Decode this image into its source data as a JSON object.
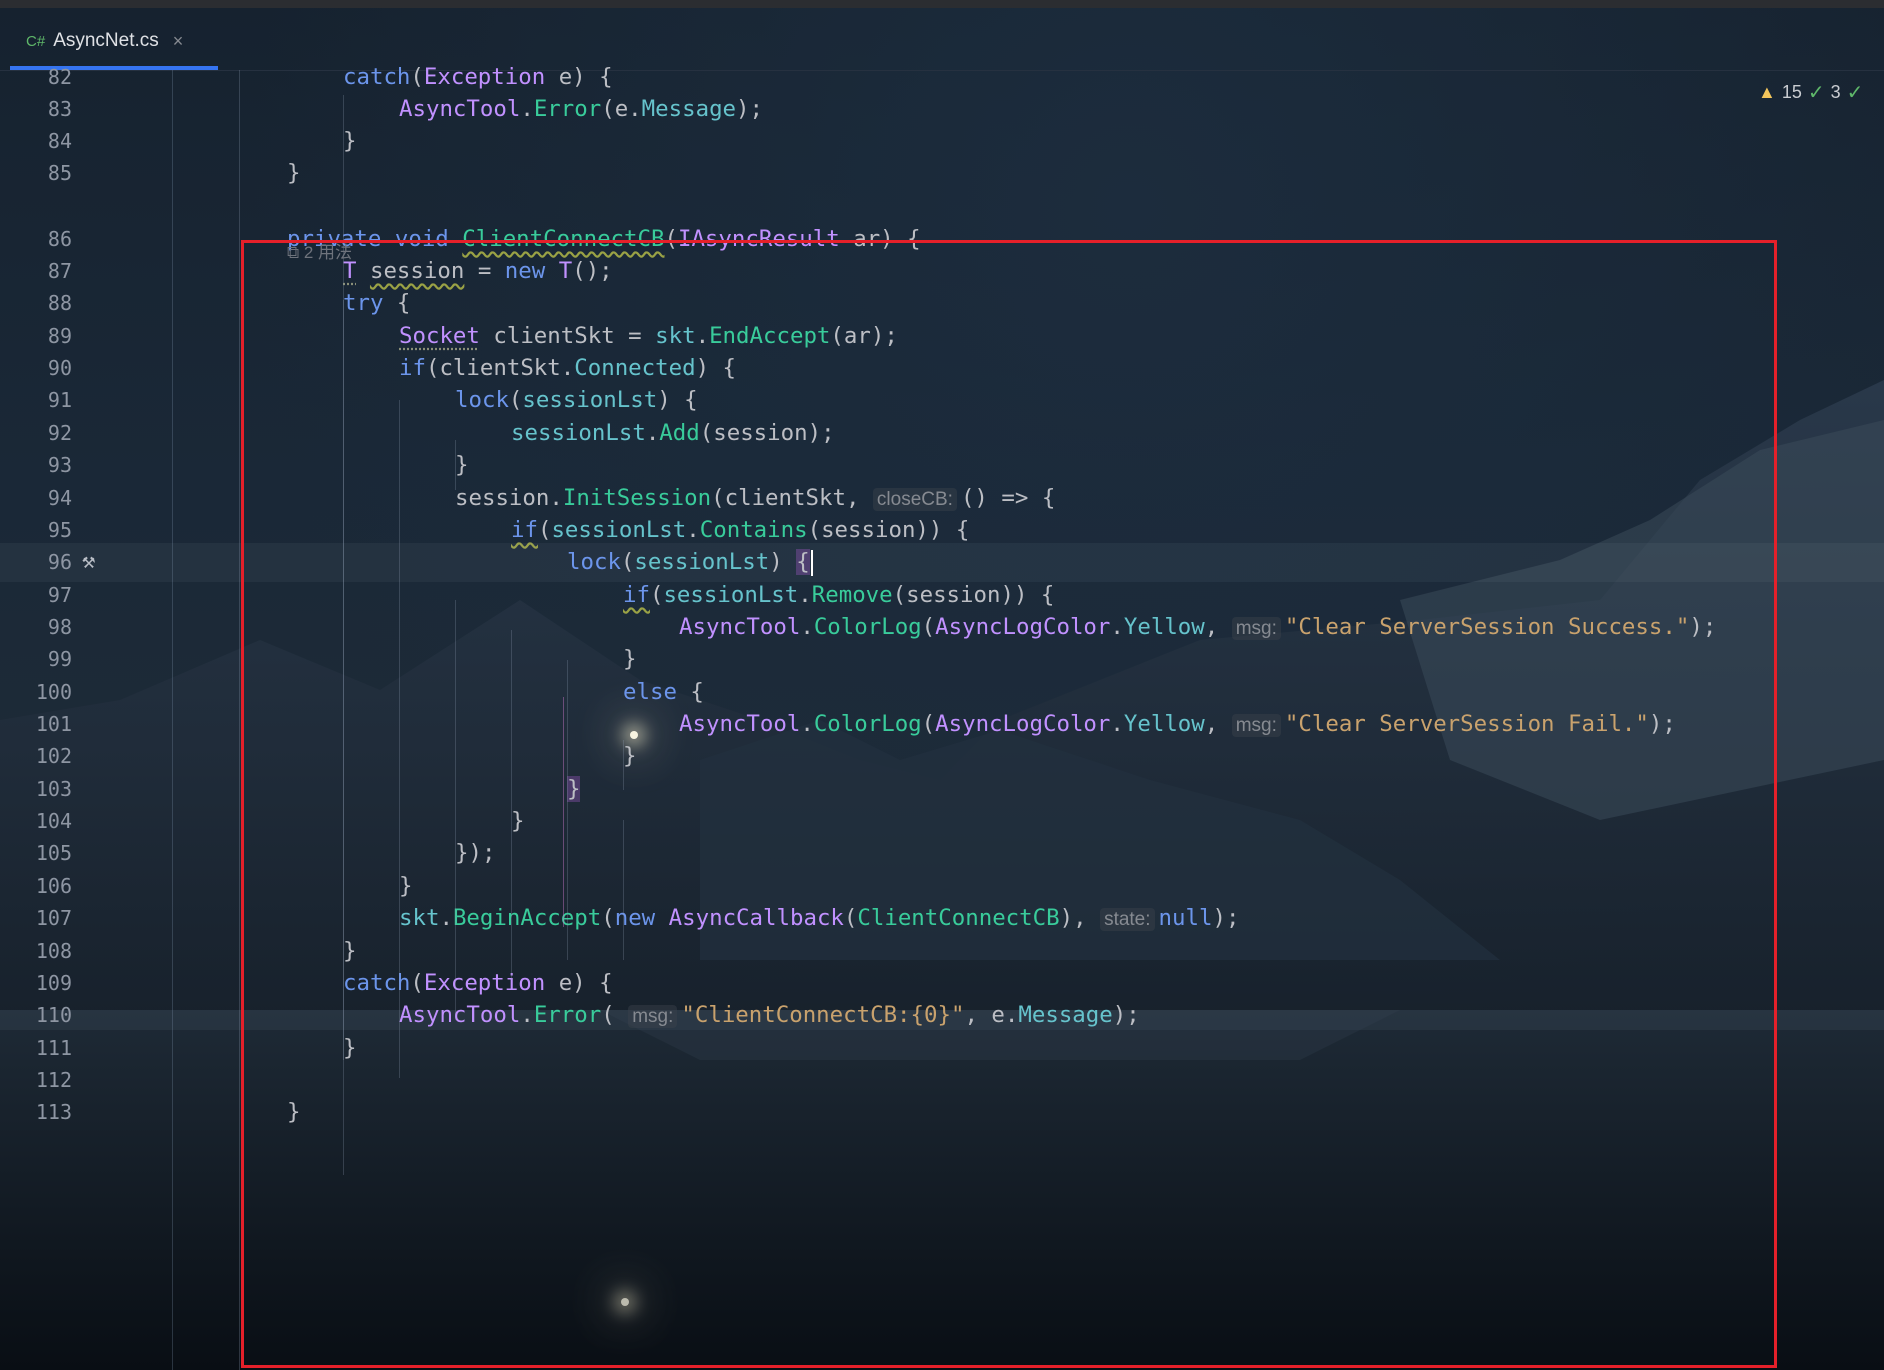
{
  "editor": {
    "tab": {
      "icon_text": "C#",
      "title": "AsyncNet.cs",
      "close_label": "×"
    },
    "status": {
      "warnings": "15",
      "checks": "3"
    },
    "usages_hint": "2 用法",
    "current_line": "96",
    "lines": [
      {
        "n": "82",
        "indent": 1,
        "tokens": [
          [
            "catch",
            "kw"
          ],
          [
            "(",
            "pl"
          ],
          [
            "Exception",
            "ty"
          ],
          [
            " e) {",
            "pl"
          ]
        ]
      },
      {
        "n": "83",
        "indent": 2,
        "tokens": [
          [
            "AsyncTool",
            "ty"
          ],
          [
            ".",
            "pl"
          ],
          [
            "Error",
            "fn"
          ],
          [
            "(e.",
            "pl"
          ],
          [
            "Message",
            "prop"
          ],
          [
            ");",
            "pl"
          ]
        ]
      },
      {
        "n": "84",
        "indent": 1,
        "tokens": [
          [
            "}",
            "pl"
          ]
        ]
      },
      {
        "n": "85",
        "indent": 0,
        "tokens": [
          [
            "}",
            "pl"
          ]
        ]
      },
      {
        "n": "86",
        "indent": 0,
        "tokens": [
          [
            "private",
            "kw"
          ],
          [
            " ",
            "pl"
          ],
          [
            "void",
            "kw"
          ],
          [
            " ",
            "pl"
          ],
          [
            "ClientConnectCB",
            "fn wav"
          ],
          [
            "(",
            "pl"
          ],
          [
            "IAsyncResult",
            "ty"
          ],
          [
            " ar) {",
            "pl"
          ]
        ]
      },
      {
        "n": "87",
        "indent": 1,
        "tokens": [
          [
            "T",
            "ty dot"
          ],
          [
            " ",
            "pl"
          ],
          [
            "session",
            "pl wav"
          ],
          [
            " = ",
            "pl"
          ],
          [
            "new",
            "kw"
          ],
          [
            " ",
            "pl"
          ],
          [
            "T",
            "ty"
          ],
          [
            "();",
            "pl"
          ]
        ]
      },
      {
        "n": "88",
        "indent": 1,
        "tokens": [
          [
            "try",
            "kw"
          ],
          [
            " {",
            "pl"
          ]
        ]
      },
      {
        "n": "89",
        "indent": 2,
        "tokens": [
          [
            "Socket",
            "ty dot"
          ],
          [
            " clientSkt = ",
            "pl"
          ],
          [
            "skt",
            "prop"
          ],
          [
            ".",
            "pl"
          ],
          [
            "EndAccept",
            "fn"
          ],
          [
            "(ar);",
            "pl"
          ]
        ]
      },
      {
        "n": "90",
        "indent": 2,
        "tokens": [
          [
            "if",
            "kw"
          ],
          [
            "(clientSkt.",
            "pl"
          ],
          [
            "Connected",
            "prop"
          ],
          [
            ") {",
            "pl"
          ]
        ]
      },
      {
        "n": "91",
        "indent": 3,
        "tokens": [
          [
            "lock",
            "kw"
          ],
          [
            "(",
            "pl"
          ],
          [
            "sessionLst",
            "prop"
          ],
          [
            ") {",
            "pl"
          ]
        ]
      },
      {
        "n": "92",
        "indent": 4,
        "tokens": [
          [
            "sessionLst",
            "prop"
          ],
          [
            ".",
            "pl"
          ],
          [
            "Add",
            "fn"
          ],
          [
            "(session);",
            "pl"
          ]
        ]
      },
      {
        "n": "93",
        "indent": 3,
        "tokens": [
          [
            "}",
            "pl"
          ]
        ]
      },
      {
        "n": "94",
        "indent": 3,
        "tokens": [
          [
            "session.",
            "pl"
          ],
          [
            "InitSession",
            "fn"
          ],
          [
            "(clientSkt, ",
            "pl"
          ],
          [
            "closeCB:",
            "hint"
          ],
          [
            "() => {",
            "pl"
          ]
        ]
      },
      {
        "n": "95",
        "indent": 4,
        "tokens": [
          [
            "if",
            "kw wav"
          ],
          [
            "(",
            "pl"
          ],
          [
            "sessionLst",
            "prop"
          ],
          [
            ".",
            "pl"
          ],
          [
            "Contains",
            "fn"
          ],
          [
            "(session)) {",
            "pl"
          ]
        ]
      },
      {
        "n": "96",
        "indent": 5,
        "tokens": [
          [
            "lock",
            "kw"
          ],
          [
            "(",
            "pl"
          ],
          [
            "sessionLst",
            "prop"
          ],
          [
            ") ",
            "pl"
          ],
          [
            "{",
            "pl bh"
          ],
          [
            "",
            "caret"
          ]
        ]
      },
      {
        "n": "97",
        "indent": 6,
        "tokens": [
          [
            "if",
            "kw wav"
          ],
          [
            "(",
            "pl"
          ],
          [
            "sessionLst",
            "prop"
          ],
          [
            ".",
            "pl"
          ],
          [
            "Remove",
            "fn"
          ],
          [
            "(session)) {",
            "pl"
          ]
        ]
      },
      {
        "n": "98",
        "indent": 7,
        "tokens": [
          [
            "AsyncTool",
            "ty"
          ],
          [
            ".",
            "pl"
          ],
          [
            "ColorLog",
            "fn"
          ],
          [
            "(",
            "pl"
          ],
          [
            "AsyncLogColor",
            "ty"
          ],
          [
            ".",
            "pl"
          ],
          [
            "Yellow",
            "prop"
          ],
          [
            ", ",
            "pl"
          ],
          [
            "msg:",
            "hint"
          ],
          [
            "\"Clear ServerSession Success.\"",
            "str"
          ],
          [
            ");",
            "pl"
          ]
        ]
      },
      {
        "n": "99",
        "indent": 6,
        "tokens": [
          [
            "}",
            "pl"
          ]
        ]
      },
      {
        "n": "100",
        "indent": 6,
        "tokens": [
          [
            "else",
            "kw"
          ],
          [
            " {",
            "pl"
          ]
        ]
      },
      {
        "n": "101",
        "indent": 7,
        "tokens": [
          [
            "AsyncTool",
            "ty"
          ],
          [
            ".",
            "pl"
          ],
          [
            "ColorLog",
            "fn"
          ],
          [
            "(",
            "pl"
          ],
          [
            "AsyncLogColor",
            "ty"
          ],
          [
            ".",
            "pl"
          ],
          [
            "Yellow",
            "prop"
          ],
          [
            ", ",
            "pl"
          ],
          [
            "msg:",
            "hint"
          ],
          [
            "\"Clear ServerSession Fail.\"",
            "str"
          ],
          [
            ");",
            "pl"
          ]
        ]
      },
      {
        "n": "102",
        "indent": 6,
        "tokens": [
          [
            "}",
            "pl"
          ]
        ]
      },
      {
        "n": "103",
        "indent": 5,
        "tokens": [
          [
            "}",
            "pl bh"
          ]
        ]
      },
      {
        "n": "104",
        "indent": 4,
        "tokens": [
          [
            "}",
            "pl"
          ]
        ]
      },
      {
        "n": "105",
        "indent": 3,
        "tokens": [
          [
            "});",
            "pl"
          ]
        ]
      },
      {
        "n": "106",
        "indent": 2,
        "tokens": [
          [
            "}",
            "pl"
          ]
        ]
      },
      {
        "n": "107",
        "indent": 2,
        "tokens": [
          [
            "skt",
            "prop"
          ],
          [
            ".",
            "pl"
          ],
          [
            "BeginAccept",
            "fn"
          ],
          [
            "(",
            "pl"
          ],
          [
            "new",
            "kw"
          ],
          [
            " ",
            "pl"
          ],
          [
            "AsyncCallback",
            "ty"
          ],
          [
            "(",
            "pl"
          ],
          [
            "ClientConnectCB",
            "fn"
          ],
          [
            "), ",
            "pl"
          ],
          [
            "state:",
            "hint"
          ],
          [
            "null",
            "kw"
          ],
          [
            ");",
            "pl"
          ]
        ]
      },
      {
        "n": "108",
        "indent": 1,
        "tokens": [
          [
            "}",
            "pl"
          ]
        ]
      },
      {
        "n": "109",
        "indent": 1,
        "tokens": [
          [
            "catch",
            "kw"
          ],
          [
            "(",
            "pl"
          ],
          [
            "Exception",
            "ty"
          ],
          [
            " e) {",
            "pl"
          ]
        ]
      },
      {
        "n": "110",
        "indent": 2,
        "tokens": [
          [
            "AsyncTool",
            "ty"
          ],
          [
            ".",
            "pl"
          ],
          [
            "Error",
            "fn"
          ],
          [
            "( ",
            "pl"
          ],
          [
            "msg:",
            "hint"
          ],
          [
            "\"ClientConnectCB:{0}\"",
            "str"
          ],
          [
            ", e.",
            "pl"
          ],
          [
            "Message",
            "prop"
          ],
          [
            ");",
            "pl"
          ]
        ]
      },
      {
        "n": "111",
        "indent": 1,
        "tokens": [
          [
            "}",
            "pl"
          ]
        ]
      },
      {
        "n": "112",
        "indent": 0,
        "tokens": []
      },
      {
        "n": "113",
        "indent": 0,
        "tokens": [
          [
            "}",
            "pl"
          ]
        ]
      }
    ]
  },
  "colors": {
    "accent": "#3574f0",
    "keyword": "#6c95eb",
    "type": "#c191ff",
    "method": "#39cc9b",
    "property": "#66c3cc",
    "string": "#c9a26d",
    "highlight_box": "#e5202a"
  },
  "icons": [
    "csharp-file-icon",
    "close-icon",
    "warning-icon",
    "check-icon",
    "hammer-icon"
  ]
}
